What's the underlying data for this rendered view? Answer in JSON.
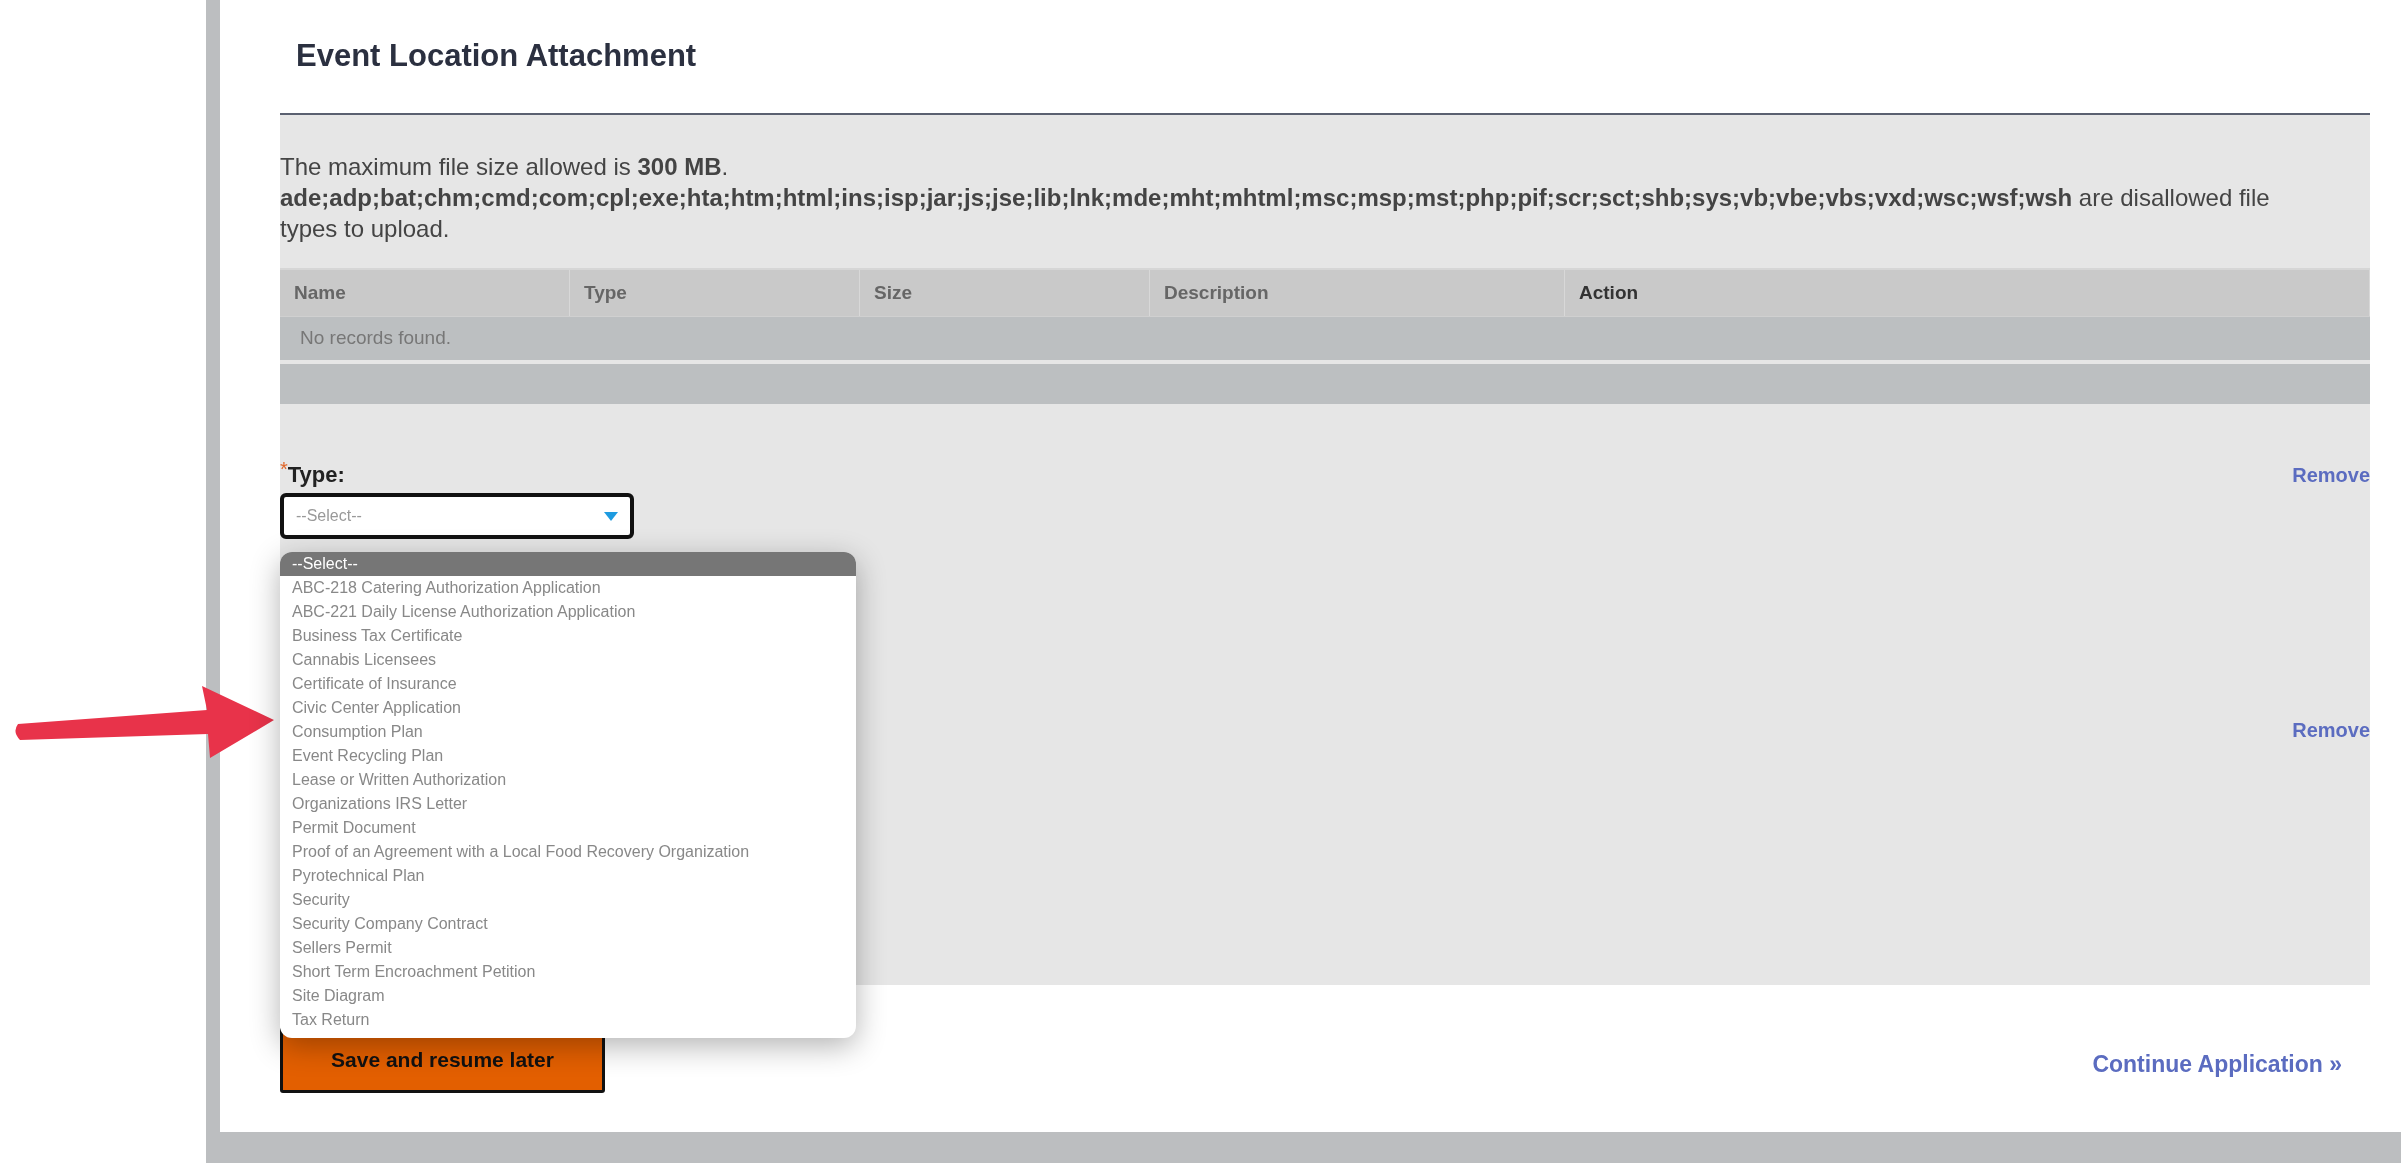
{
  "section": {
    "title": "Event Location Attachment"
  },
  "info": {
    "size_note": "The maximum file size allowed is **300 MB**.",
    "disallowed_note": "**ade;adp;bat;chm;cmd;com;cpl;exe;hta;htm;html;ins;isp;jar;js;jse;lib;lnk;mde;mht;mhtml;msc;msp;mst;php;pif;scr;sct;shb;sys;vb;vbe;vbs;vxd;wsc;wsf;wsh** are disallowed file types to upload."
  },
  "table": {
    "columns": [
      "Name",
      "Type",
      "Size",
      "Description",
      "Action"
    ],
    "empty_message": "No records found."
  },
  "attachments": [
    {
      "remove": "Remove",
      "type_field": {
        "label": "Type:",
        "required_mark": "*",
        "value": "--Select--",
        "expanded": true,
        "options": [
          {
            "label": "--Select--",
            "selected": true
          },
          {
            "label": "ABC-218 Catering Authorization Application",
            "selected": false
          },
          {
            "label": "ABC-221 Daily License Authorization Application",
            "selected": false
          },
          {
            "label": "Business Tax Certificate",
            "selected": false
          },
          {
            "label": "Cannabis Licensees",
            "selected": false
          },
          {
            "label": "Certificate of Insurance",
            "selected": false
          },
          {
            "label": "Civic Center Application",
            "selected": false
          },
          {
            "label": "Consumption Plan",
            "selected": false
          },
          {
            "label": "Event Recycling Plan",
            "selected": false
          },
          {
            "label": "Lease or Written Authorization",
            "selected": false
          },
          {
            "label": "Organizations IRS Letter",
            "selected": false
          },
          {
            "label": "Permit Document",
            "selected": false
          },
          {
            "label": "Proof of an Agreement with a Local Food Recovery Organization",
            "selected": false
          },
          {
            "label": "Pyrotechnical Plan",
            "selected": false
          },
          {
            "label": "Security",
            "selected": false
          },
          {
            "label": "Security Company Contract",
            "selected": false
          },
          {
            "label": "Sellers Permit",
            "selected": false
          },
          {
            "label": "Short Term Encroachment Petition",
            "selected": false
          },
          {
            "label": "Site Diagram",
            "selected": false
          },
          {
            "label": "Tax Return",
            "selected": false
          }
        ]
      }
    },
    {
      "remove": "Remove"
    }
  ],
  "buttons": {
    "save": "Save and resume later",
    "continue": "Continue Application »"
  }
}
